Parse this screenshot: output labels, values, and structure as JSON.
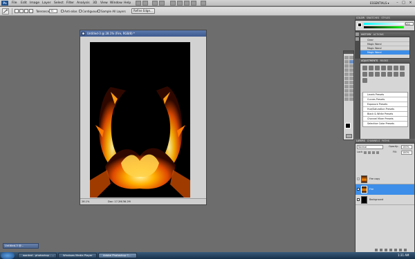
{
  "menu": {
    "logo": "Ps",
    "items": [
      "File",
      "Edit",
      "Image",
      "Layer",
      "Select",
      "Filter",
      "Analysis",
      "3D",
      "View",
      "Window",
      "Help"
    ],
    "workspace": "ESSENTIALS ▾",
    "window_controls": [
      "–",
      "□",
      "×"
    ]
  },
  "options": {
    "tolerance_label": "Tolerance:",
    "tolerance_value": "32",
    "anti_alias": "Anti-alias",
    "contiguous": "Contiguous",
    "sample_all_layers": "Sample All Layers",
    "refine_edge": "Refine Edge..."
  },
  "document": {
    "title": "Untitled-3 @ 28.1% (Fire, RGB/8) *",
    "zoom": "28.1%",
    "doc_info": "Doc: 17.2M/36.2M"
  },
  "color_panel": {
    "tabs": [
      "COLOR",
      "SWATCHES",
      "STYLES"
    ],
    "r_value": "255"
  },
  "history_panel": {
    "tabs": [
      "HISTORY",
      "ACTIONS"
    ],
    "items": [
      "Clear",
      "Magic Wand",
      "Magic Wand",
      "Magic Wand"
    ],
    "selected_index": 3
  },
  "adjustments_panel": {
    "tabs": [
      "ADJUSTMENTS",
      "MASKS"
    ],
    "presets": [
      "Levels Presets",
      "Curves Presets",
      "Exposure Presets",
      "Hue/Saturation Presets",
      "Black & White Presets",
      "Channel Mixer Presets",
      "Selective Color Presets"
    ]
  },
  "layers_panel": {
    "tabs": [
      "LAYERS",
      "CHANNELS",
      "PATHS"
    ],
    "blend_mode": "Normal",
    "opacity_label": "Opacity:",
    "opacity_value": "100%",
    "lock_label": "Lock:",
    "fill_label": "Fill:",
    "fill_value": "100%",
    "layers": [
      {
        "name": "Fire copy",
        "visible": false,
        "selected": false
      },
      {
        "name": "Fire",
        "visible": true,
        "selected": true
      },
      {
        "name": "Background",
        "visible": true,
        "selected": false
      }
    ]
  },
  "minimized_window": "Untitled-3 @...",
  "taskbar": {
    "items": [
      "wanted - photoshop - ...",
      "Windows Media Player",
      "Adobe Photoshop C..."
    ],
    "clock": "1:31 AM"
  },
  "colors": {
    "accent": "#3d8ee8",
    "selection": "#4aa3ff",
    "fire": "#ff8a00"
  }
}
